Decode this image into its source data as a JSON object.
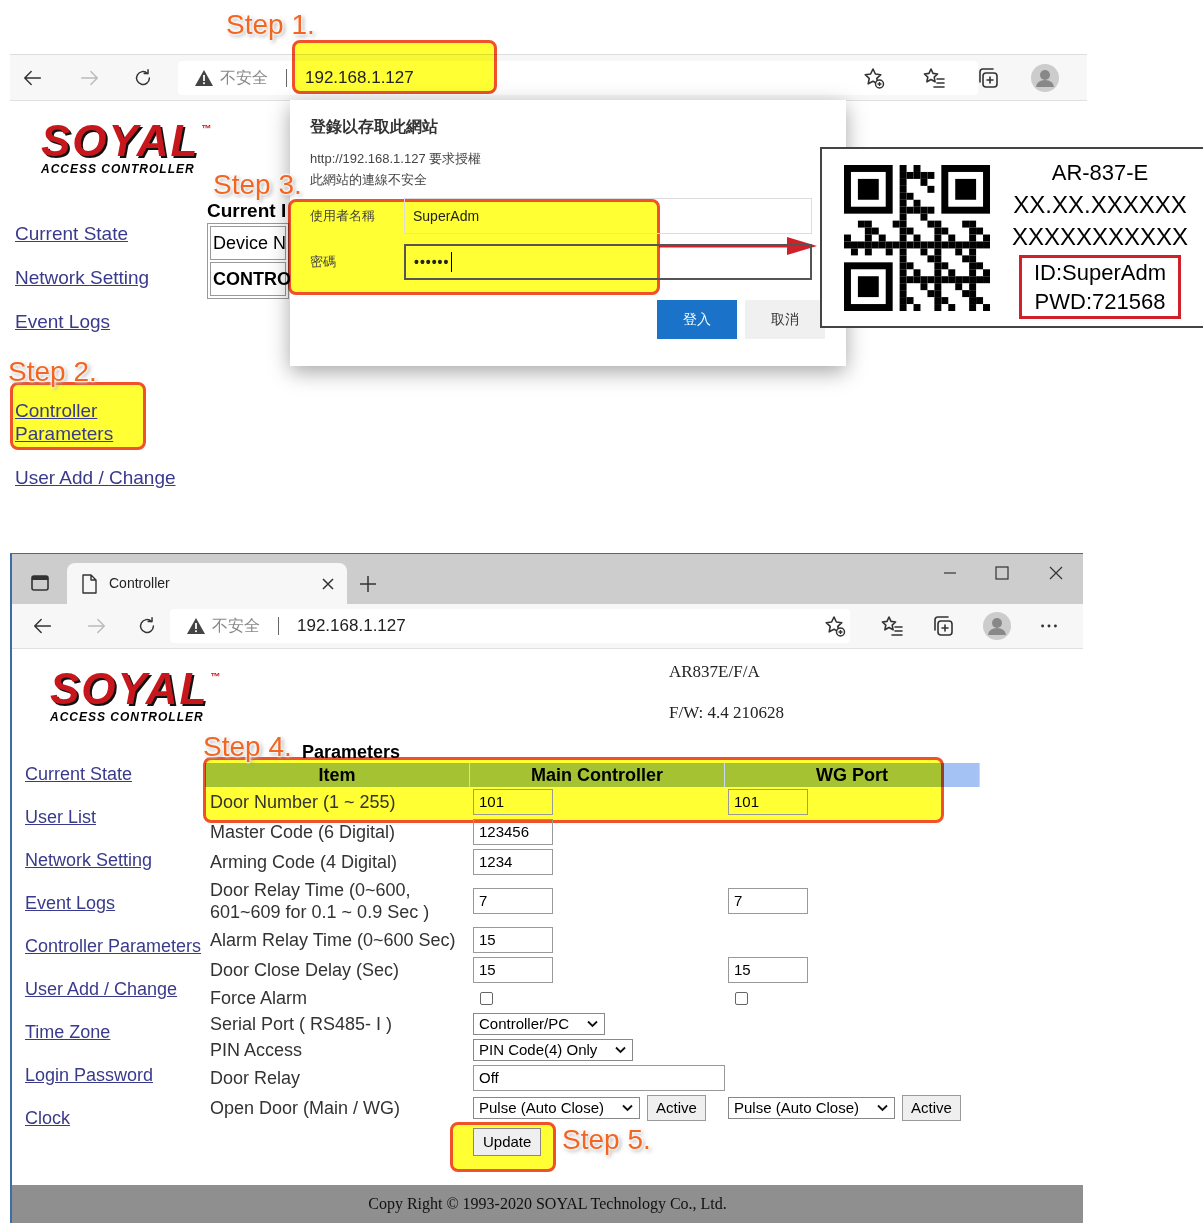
{
  "annotations": [
    {
      "label": "Step 1."
    },
    {
      "label": "Step 2."
    },
    {
      "label": "Step 3."
    },
    {
      "label": "Step 4."
    },
    {
      "label": "Step 5."
    }
  ],
  "top_browser": {
    "security": "不安全",
    "url": "192.168.1.127"
  },
  "top_page": {
    "logo": {
      "name": "SOYAL",
      "tm": "™",
      "tagline": "ACCESS CONTROLLER"
    },
    "nav": [
      {
        "label": "Current State"
      },
      {
        "label": "Network Setting"
      },
      {
        "label": "Event Logs"
      },
      {
        "label": "Controller Parameters"
      },
      {
        "label": "User Add / Change"
      }
    ],
    "heading": "Current I",
    "table_cells": [
      "Device N",
      "CONTRO"
    ]
  },
  "login_dialog": {
    "title": "登錄以存取此網站",
    "message": "http://192.168.1.127 要求授權",
    "warning": "此網站的連線不安全",
    "fields": [
      {
        "label": "使用者名稱",
        "value": "SuperAdm",
        "kind": "text"
      },
      {
        "label": "密碼",
        "value": "••••••",
        "kind": "password"
      }
    ],
    "buttons": [
      {
        "label": "登入",
        "kind": "primary"
      },
      {
        "label": "取消",
        "kind": "secondary"
      }
    ]
  },
  "device_label": {
    "lines": [
      "AR-837-E",
      "XX.XX.XXXXXX",
      "XXXXXXXXXXX"
    ],
    "credentials": [
      "ID:SuperAdm",
      "PWD:721568"
    ]
  },
  "bottom_browser": {
    "tab_title": "Controller",
    "security": "不安全",
    "url": "192.168.1.127"
  },
  "bottom_page": {
    "logo": {
      "name": "SOYAL",
      "tm": "™",
      "tagline": "ACCESS CONTROLLER"
    },
    "model": "AR837E/F/A",
    "firmware": "F/W: 4.4 210628",
    "nav": [
      {
        "label": "Current State"
      },
      {
        "label": "User List"
      },
      {
        "label": "Network Setting"
      },
      {
        "label": "Event Logs"
      },
      {
        "label": "Controller Parameters"
      },
      {
        "label": "User Add / Change"
      },
      {
        "label": "Time Zone"
      },
      {
        "label": "Login Password"
      },
      {
        "label": "Clock"
      }
    ],
    "heading": "Parameters",
    "columns": [
      "Item",
      "Main Controller",
      "WG Port"
    ],
    "rows": [
      {
        "item": "Door Number (1 ~ 255)",
        "main": {
          "kind": "input",
          "value": "101"
        },
        "wg": {
          "kind": "input",
          "value": "101"
        }
      },
      {
        "item": "Master Code (6 Digital)",
        "main": {
          "kind": "input",
          "value": "123456"
        }
      },
      {
        "item": "Arming Code (4 Digital)",
        "main": {
          "kind": "input",
          "value": "1234"
        }
      },
      {
        "item": "Door Relay Time (0~600,\n601~609 for 0.1 ~ 0.9 Sec )",
        "main": {
          "kind": "input",
          "value": "7"
        },
        "wg": {
          "kind": "input",
          "value": "7"
        }
      },
      {
        "item": "Alarm Relay Time (0~600 Sec)",
        "main": {
          "kind": "input",
          "value": "15"
        }
      },
      {
        "item": "Door Close Delay (Sec)",
        "main": {
          "kind": "input",
          "value": "15"
        },
        "wg": {
          "kind": "input",
          "value": "15"
        }
      },
      {
        "item": "Force Alarm",
        "main": {
          "kind": "checkbox",
          "checked": false
        },
        "wg": {
          "kind": "checkbox",
          "checked": false
        }
      },
      {
        "item": "Serial Port ( RS485- I  )",
        "main": {
          "kind": "select",
          "value": "Controller/PC"
        }
      },
      {
        "item": "PIN Access",
        "main": {
          "kind": "select",
          "value": "PIN Code(4) Only"
        }
      },
      {
        "item": "Door Relay",
        "main": {
          "kind": "wide_input",
          "value": "Off"
        }
      },
      {
        "item": "Open Door (Main / WG)",
        "main": {
          "kind": "select_button",
          "value": "Pulse (Auto Close)",
          "button": "Active"
        },
        "wg": {
          "kind": "select_button",
          "value": "Pulse (Auto Close)",
          "button": "Active"
        }
      }
    ],
    "update_button": "Update",
    "footer": "Copy Right © 1993-2020 SOYAL Technology Co., Ltd."
  }
}
